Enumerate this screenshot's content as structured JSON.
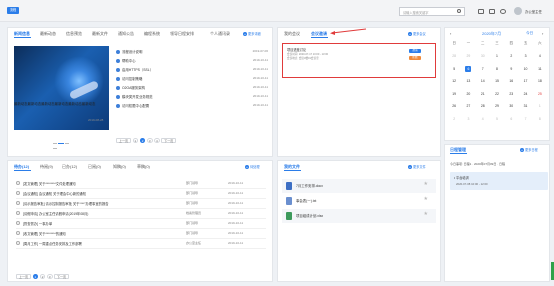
{
  "top": {
    "logo": "流程",
    "search_placeholder": "请输入搜索关键字",
    "user": "办公室主任"
  },
  "news": {
    "tabs": [
      "新闻信息",
      "最新动态",
      "信息预览",
      "最新文件",
      "通知公告",
      "编程系统",
      "领导日程安排",
      "个人通讯录"
    ],
    "more": "更多详细",
    "caption": "最新动态最新动态最新动态最新动态最新动态最新动态",
    "caption_date": "2019-08-28",
    "items": [
      {
        "t": "流程设计说明",
        "d": "2019-07-06"
      },
      {
        "t": "帮助中心",
        "d": "2019-10-11"
      },
      {
        "t": "启用HTTPS（SSL）",
        "d": "2019-10-11"
      },
      {
        "t": "访问控制策略",
        "d": "2019-10-11"
      },
      {
        "t": "O2OA服务架构",
        "d": "2019-10-11"
      },
      {
        "t": "模块类开发业务规范",
        "d": "2019-10-11"
      },
      {
        "t": "访问权限中心配置",
        "d": "2019-10-11"
      }
    ],
    "pager": {
      "prev": "上一页",
      "pages": [
        "1",
        "2",
        "3",
        "4"
      ],
      "next": "下一页",
      "current": "2"
    }
  },
  "meeting": {
    "tabs": [
      "我的会议",
      "会议邀请"
    ],
    "more": "更多会议",
    "items": [
      {
        "title": "项目进度讨论",
        "time": "会议时间: 2020-07-17 10:00 - 13:00",
        "room": "会议地点: 会议3楼01会议室",
        "tag": "邀请",
        "tag_color": "#2b7de9"
      },
      {
        "tag": "拒绝",
        "tag_color": "#f08a3a"
      }
    ]
  },
  "calendar": {
    "title": "2020年7月",
    "today_btn": "今日",
    "weekdays": [
      "日",
      "一",
      "二",
      "三",
      "四",
      "五",
      "六"
    ],
    "rows": [
      [
        "28",
        "29",
        "30",
        "1",
        "2",
        "3",
        "4"
      ],
      [
        "5",
        "6",
        "7",
        "8",
        "9",
        "10",
        "11"
      ],
      [
        "12",
        "13",
        "14",
        "15",
        "16",
        "17",
        "18"
      ],
      [
        "19",
        "20",
        "21",
        "22",
        "23",
        "24",
        "25"
      ],
      [
        "26",
        "27",
        "28",
        "29",
        "30",
        "31",
        "1"
      ],
      [
        "2",
        "3",
        "4",
        "5",
        "6",
        "7",
        "8"
      ]
    ]
  },
  "todo": {
    "tabs": [
      "待办(12)",
      "待阅(9)",
      "已办(12)",
      "已阅(0)",
      "知稿(0)",
      "草稿(0)"
    ],
    "more": "待处理",
    "items": [
      {
        "t": "[发文管理] 关于********文件处理通知",
        "p": "部门领导",
        "d": "2019-10-11"
      },
      {
        "t": "[会议通知] 会议通知 关于理会中心新的通知",
        "p": "部门领导",
        "d": "2019-10-11"
      },
      {
        "t": "[请示报告审批] 请示控制报告审批 关于“***”办理事宜的报告",
        "p": "部门领导",
        "d": "2019-10-11"
      },
      {
        "t": "[请假申请] 办公室主任请假申请(2019年08月)",
        "p": "档案管理员",
        "d": "2019-10-11"
      },
      {
        "t": "[督查督办] 一事办单",
        "p": "部门领导",
        "d": "2019-10-11"
      },
      {
        "t": "[收文管理] 关于********的通知",
        "p": "部门领导",
        "d": "2019-10-11"
      },
      {
        "t": "[周月工作] 一周重点任务安排及工作部署",
        "p": "办公室主任",
        "d": "2019-10-11"
      }
    ],
    "pager": {
      "prev": "上一页",
      "pages": [
        "1",
        "2",
        "3"
      ],
      "next": "下一页",
      "current": "1"
    }
  },
  "files": {
    "title": "我的文件",
    "more": "更多文件",
    "items": [
      "7月工作安排.docx",
      "事会表(一).txt",
      "项目组成计划.xlsx"
    ]
  },
  "schedule": {
    "title": "日程管理",
    "more": "更多日程",
    "line": "今日事项: 日程1 · 2020年07月09日 · 日程",
    "item_title": "• 平台培训",
    "item_time": "2020-07-08 10:00 - 12:00"
  }
}
